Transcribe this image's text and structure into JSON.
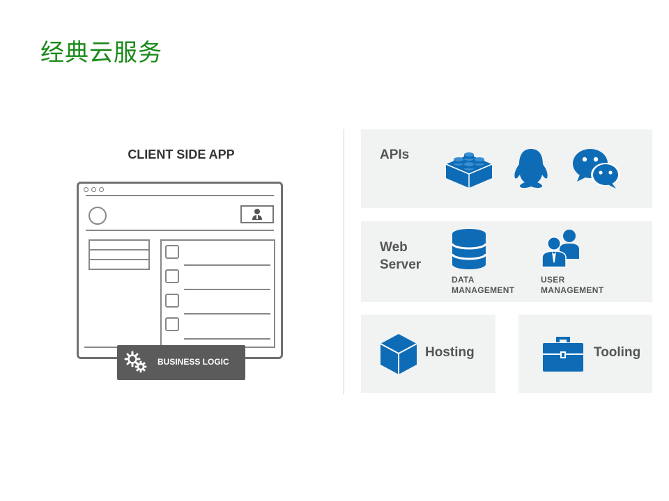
{
  "slide": {
    "title": "经典云服务"
  },
  "client_side": {
    "title": "CLIENT SIDE APP",
    "business_logic_label": "BUSINESS LOGIC"
  },
  "services": {
    "apis": {
      "title": "APIs"
    },
    "web_server": {
      "title_line1": "Web",
      "title_line2": "Server",
      "data_management_line1": "DATA",
      "data_management_line2": "MANAGEMENT",
      "user_management_line1": "USER",
      "user_management_line2": "MANAGEMENT"
    },
    "hosting": {
      "title": "Hosting"
    },
    "tooling": {
      "title": "Tooling"
    }
  },
  "colors": {
    "title_green": "#1a8a1a",
    "icon_blue": "#0e6cb6",
    "panel_gray": "#f1f2f2",
    "logic_bar_gray": "#5b5b5b"
  }
}
